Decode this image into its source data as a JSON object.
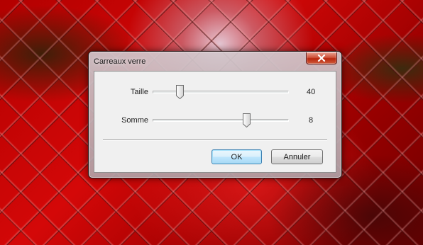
{
  "dialog": {
    "title": "Carreaux verre",
    "close_icon": "close-icon",
    "sliders": [
      {
        "label": "Taille",
        "value": "40",
        "position_fraction": 0.2
      },
      {
        "label": "Somme",
        "value": "8",
        "position_fraction": 0.69
      }
    ],
    "buttons": {
      "ok_label": "OK",
      "cancel_label": "Annuler"
    }
  },
  "colors": {
    "close_button": "#c7402a",
    "default_button_border": "#3c7fb1",
    "background_red": "#c00000"
  }
}
